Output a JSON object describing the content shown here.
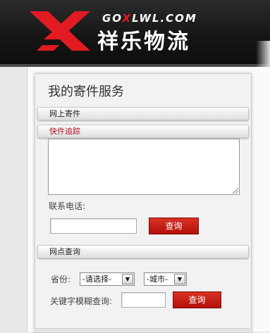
{
  "logo": {
    "domain_prefix": "GO",
    "domain_x": "X",
    "domain_suffix": "LWL.COM",
    "name_cn": "祥乐物流"
  },
  "panel": {
    "title": "我的寄件服务",
    "sections": [
      {
        "label": "网上寄件",
        "active": false
      },
      {
        "label": "快件追踪",
        "active": true
      },
      {
        "label": "网点查询",
        "active": false
      }
    ]
  },
  "tracking": {
    "textarea_value": "",
    "phone_label": "联系电话:",
    "phone_value": "",
    "query_button": "查询"
  },
  "branch": {
    "province_label": "省份:",
    "province_selected": "-请选择-",
    "city_selected": "-城市-",
    "keyword_label": "关键字模糊查询:",
    "keyword_value": "",
    "query_button": "查询"
  },
  "colors": {
    "brand_red": "#e21a22",
    "active_tab_text": "#b20e1d",
    "button_red": "#c4210f",
    "header_bg": "#1a1a1a"
  }
}
